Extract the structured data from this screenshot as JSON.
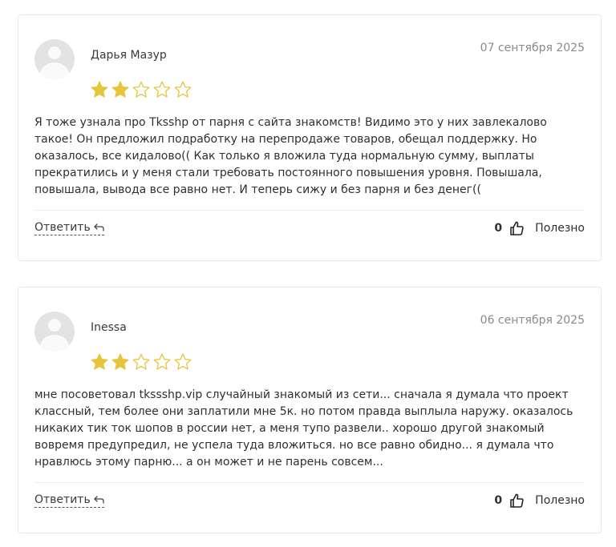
{
  "reviews": [
    {
      "author": "Дарья Мазур",
      "date": "07 сентября 2025",
      "rating": 2,
      "max_rating": 5,
      "text": "Я тоже узнала про Tksshp от парня с сайта знакомств! Видимо это у них завлекалово такое! Он предложил подработку на перепродаже товаров, обещал поддержку. Но оказалось, все кидалово(( Как только я вложила туда нормальную сумму, выплаты прекратились и у меня стали требовать постоянного повышения уровня. Повышала, повышала, вывода все равно нет. И теперь сижу и без парня и без денег((",
      "reply_label": "Ответить",
      "helpful_count": "0",
      "helpful_label": "Полезно"
    },
    {
      "author": "Inessa",
      "date": "06 сентября 2025",
      "rating": 2,
      "max_rating": 5,
      "text": "мне посоветовал tkssshp.vip случайный знакомый из сети... сначала я думала что проект классный, тем более они заплатили мне 5к. но потом правда выплыла наружу. оказалось никаких тик ток шопов в россии нет, а меня тупо развели.. хорошо другой знакомый вовремя предупредил, не успела туда вложиться. но все равно обидно... я думала что нравлюсь этому парню... а он может и не парень совсем...",
      "reply_label": "Ответить",
      "helpful_count": "0",
      "helpful_label": "Полезно"
    }
  ],
  "colors": {
    "star_filled": "#e6c53c",
    "star_empty": "#e6c53c",
    "border": "#e8e8e8",
    "date": "#8a8a8a"
  },
  "icons": {
    "avatar": "user-avatar-placeholder",
    "star_filled": "star-filled-icon",
    "star_empty": "star-outline-icon",
    "reply": "reply-arrow-icon",
    "helpful": "thumbs-up-icon"
  }
}
